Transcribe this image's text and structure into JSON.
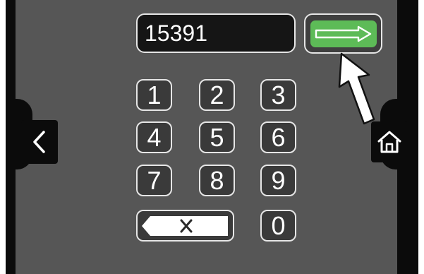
{
  "entry": {
    "value": "15391"
  },
  "enter_button": {
    "icon": "right-arrow-icon",
    "color": "#5dbb57"
  },
  "keypad": {
    "keys": [
      {
        "id": "1",
        "label": "1"
      },
      {
        "id": "2",
        "label": "2"
      },
      {
        "id": "3",
        "label": "3"
      },
      {
        "id": "4",
        "label": "4"
      },
      {
        "id": "5",
        "label": "5"
      },
      {
        "id": "6",
        "label": "6"
      },
      {
        "id": "7",
        "label": "7"
      },
      {
        "id": "8",
        "label": "8"
      },
      {
        "id": "9",
        "label": "9"
      },
      {
        "id": "0",
        "label": "0"
      }
    ],
    "backspace": {
      "icon": "backspace-icon"
    }
  },
  "nav": {
    "back": {
      "icon": "chevron-left-icon"
    },
    "home": {
      "icon": "home-icon"
    }
  },
  "annotation": {
    "icon": "pointer-arrow-icon"
  }
}
